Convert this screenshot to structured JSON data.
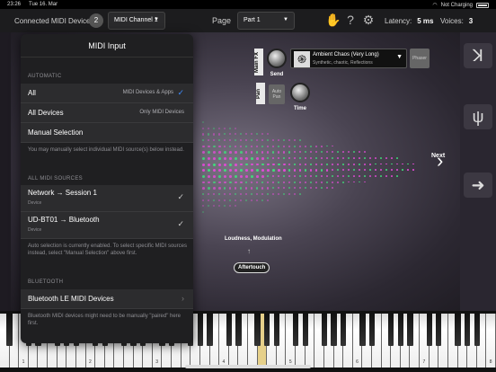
{
  "status": {
    "time": "23:26",
    "date": "Tue 16. Mar",
    "charging": "Not Charging",
    "battery_icon": "battery-icon",
    "wifi_icon": "wifi-icon"
  },
  "toolbar": {
    "connected_label": "Connected MIDI Devices:",
    "connected_count": "2",
    "channel_value": "MIDI Channel 1",
    "page_label": "Page",
    "page_value": "Part 1",
    "latency_label": "Latency:",
    "latency_value": "5 ms",
    "voices_label": "Voices:",
    "voices_value": "3"
  },
  "fx": {
    "main_fx_label": "Main FX",
    "send_label": "Send",
    "preset_name": "Ambient Chaos (Very Long)",
    "preset_sub": "Synthetic, chaotic, Reflections",
    "phaser_label": "Phaser",
    "pan_label": "Pan",
    "autopan_line1": "Auto",
    "autopan_line2": "Pan",
    "time_label": "Time"
  },
  "stage": {
    "next_label": "Next",
    "modulation_label": "Loudness, Modulation",
    "aftertouch_label": "Aftertouch"
  },
  "midi_panel": {
    "title": "MIDI Input",
    "automatic_header": "AUTOMATIC",
    "options": [
      {
        "label": "All",
        "detail": "MIDI Devices & Apps",
        "selected": true
      },
      {
        "label": "All Devices",
        "detail": "Only MIDI Devices",
        "selected": false
      },
      {
        "label": "Manual Selection",
        "detail": "",
        "selected": false
      }
    ],
    "manual_note": "You may manually select individual MIDI source(s) below instead.",
    "all_sources_header": "ALL MIDI SOURCES",
    "sources": [
      {
        "label": "Network → Session 1",
        "sub": "Device"
      },
      {
        "label": "UD-BT01 → Bluetooth",
        "sub": "Device"
      }
    ],
    "auto_note": "Auto selection is currently enabled. To select specific MIDI sources instead, select \"Manual Selection\" above first.",
    "bluetooth_header": "BLUETOOTH",
    "bluetooth_row": "Bluetooth LE MIDI Devices",
    "bluetooth_note": "Bluetooth MIDI devices might need to be manually \"paired\" here first."
  },
  "keyboard": {
    "octave_labels": [
      "1",
      "2",
      "3",
      "4",
      "5",
      "6",
      "7",
      "8"
    ]
  },
  "colors": {
    "accent_blue": "#3d8bff",
    "dot_pink": "#e24bd6",
    "dot_green": "#3fe07a"
  }
}
